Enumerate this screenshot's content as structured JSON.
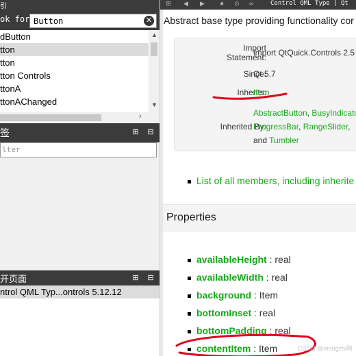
{
  "left": {
    "top_tab_fragment": "引",
    "look_for_label": "ok for:",
    "search_value": "Button",
    "clear_icon": "close-icon",
    "results": [
      "dButton",
      "tton",
      "tton",
      "tton Controls",
      "ttonA",
      "ttonAChanged"
    ],
    "selected_result_index": 1,
    "bookmarks_title": "签",
    "filter_placeholder": "lter",
    "open_pages_title": "开页面",
    "open_page_item": "ntrol QML Typ...ontrols 5.12.12"
  },
  "right": {
    "toolbar_title": "Control QML Type | Qt",
    "description": "Abstract base type providing functionality cor",
    "info": {
      "import_label_1": "Import",
      "import_label_2": "Statement:",
      "import_value": "import QtQuick.Controls 2.5",
      "since_label": "Since:",
      "since_value": "Qt 5.7",
      "inherits_label": "Inherits:",
      "inherits_value": "Item",
      "inherited_by_label": "Inherited By:",
      "inherited_by_line1_a": "AbstractButton",
      "inherited_by_line1_b": "BusyIndicato",
      "inherited_by_line2_a": "ProgressBar",
      "inherited_by_line2_b": "RangeSlider",
      "inherited_by_line3_and": "and",
      "inherited_by_line3_link": "Tumbler"
    },
    "members_link": "List of all members, including inherite",
    "properties_heading": "Properties",
    "properties": [
      {
        "name": "availableHeight",
        "type": " : real"
      },
      {
        "name": "availableWidth",
        "type": " : real"
      },
      {
        "name": "background",
        "type": " : Item"
      },
      {
        "name": "bottomInset",
        "type": " : real"
      },
      {
        "name": "bottomPadding",
        "type": " : real"
      },
      {
        "name": "contentItem",
        "type": " : Item"
      }
    ]
  },
  "watermark": "CSDN @mengzhi阿",
  "colors": {
    "link": "#17a81a",
    "annotation": "#e0001b",
    "dark_bar": "#3b3b3b"
  }
}
